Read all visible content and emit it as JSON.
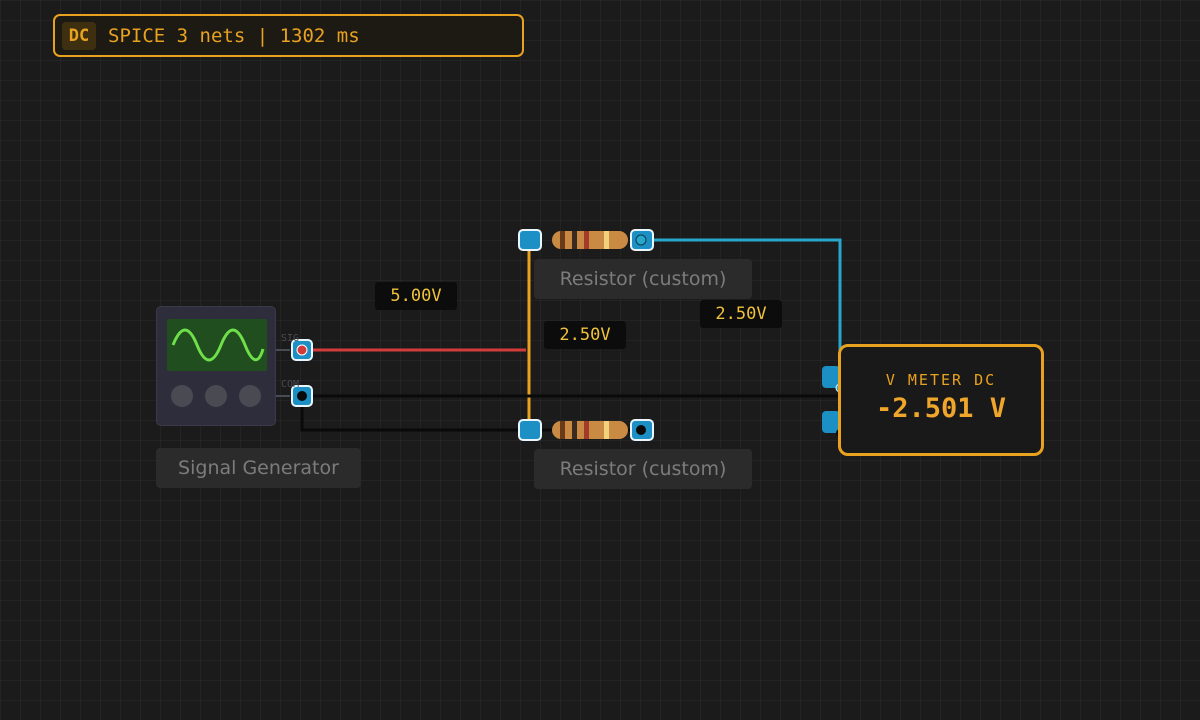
{
  "status": {
    "mode": "DC",
    "text": "SPICE 3 nets | 1302 ms"
  },
  "components": {
    "resistor_top": {
      "label": "Resistor (custom)"
    },
    "resistor_bottom": {
      "label": "Resistor (custom)"
    },
    "signal_generator": {
      "label": "Signal Generator",
      "port_sig": "SIG",
      "port_com": "COM"
    },
    "voltmeter": {
      "title": "V METER DC",
      "value": "-2.501 V"
    }
  },
  "probes": {
    "source": "5.00V",
    "mid": "2.50V",
    "right": "2.50V"
  },
  "colors": {
    "accent": "#e9a21f",
    "wire_hot": "#d33b3b",
    "wire_ground": "#0a0a0a",
    "wire_mid": "#e9a21f",
    "wire_meter": "#29a6cc",
    "pin": "#1c8fc4"
  }
}
